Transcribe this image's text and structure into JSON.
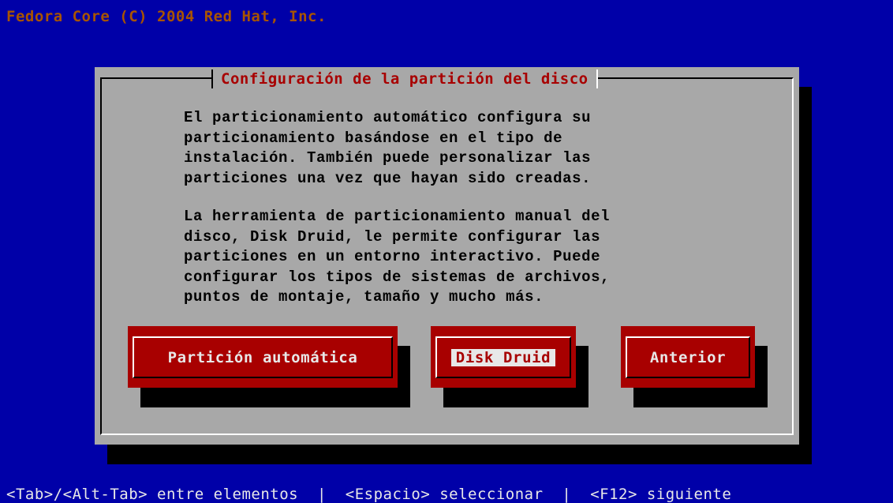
{
  "screen": {
    "title": "Fedora Core (C) 2004 Red Hat, Inc.",
    "hint": "<Tab>/<Alt-Tab> entre elementos  |  <Espacio> seleccionar  |  <F12> siguiente"
  },
  "dialog": {
    "title": "Configuración de la partición del disco",
    "paragraph1": "El particionamiento automático configura su\nparticionamiento basándose en el tipo de\ninstalación. También puede personalizar las\nparticiones una vez que hayan sido creadas.",
    "paragraph2": "La herramienta de particionamiento manual del\ndisco, Disk Druid, le permite configurar las\nparticiones en un entorno interactivo. Puede\nconfigurar los tipos de sistemas de archivos,\npuntos de montaje, tamaño y mucho más.",
    "buttons": {
      "auto": "Partición automática",
      "diskdruid": "Disk Druid",
      "back": "Anterior"
    },
    "focused_button": "diskdruid"
  },
  "colors": {
    "background": "#0000a8",
    "dialog": "#a8a8a8",
    "button": "#a80000",
    "title_text": "#a80000",
    "screen_title": "#a85400"
  }
}
